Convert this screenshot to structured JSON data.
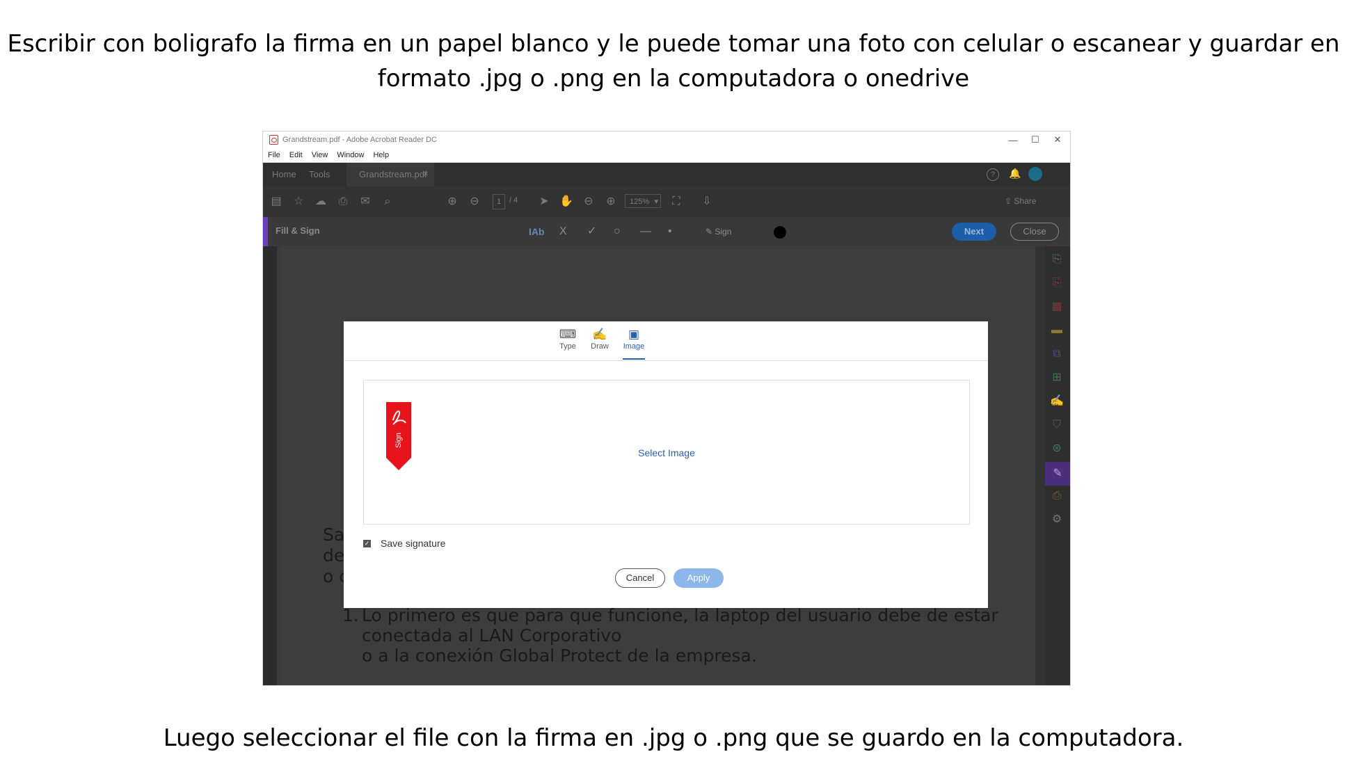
{
  "captions": {
    "top_line1": "Escribir con boligrafo la firma en un papel blanco y le puede tomar una foto con celular o escanear y guardar en",
    "top_line2": "formato .jpg o .png en la computadora o onedrive",
    "bottom": "Luego seleccionar el file con la firma en .jpg o .png que se guardo en la computadora."
  },
  "window": {
    "title": "Grandstream.pdf - Adobe Acrobat Reader DC",
    "controls": {
      "minimize": "—",
      "maximize": "☐",
      "close": "✕"
    }
  },
  "menu": [
    "File",
    "Edit",
    "View",
    "Window",
    "Help"
  ],
  "tabs": {
    "home": "Home",
    "tools": "Tools",
    "document": "Grandstream.pdf",
    "close_tab": "×"
  },
  "toolbar": {
    "page_current": "1",
    "page_total": "/ 4",
    "zoom": "125%",
    "share": "Share",
    "icons": [
      "save-icon",
      "star-icon",
      "cloud-upload-icon",
      "print-icon",
      "mail-icon",
      "search-icon",
      "page-up-icon",
      "page-down-icon",
      "select-icon",
      "hand-icon",
      "zoom-out-icon",
      "zoom-in-icon",
      "fit-page-icon",
      "scroll-mode-icon"
    ]
  },
  "fill_sign": {
    "label": "Fill & Sign",
    "text_tool": "IAb",
    "cross_tool": "X",
    "check_tool": "✓",
    "circle_tool": "○",
    "line_tool": "—",
    "dot_tool": "•",
    "sign_label": "Sign",
    "next": "Next",
    "close": "Close"
  },
  "document": {
    "frag_1": "Sa",
    "frag_2": "de",
    "frag_3": "o c",
    "item_number": "1.",
    "line_1": "Lo primero es que para que funcione, la laptop del usuario debe de estar",
    "line_2": "conectada al LAN Corporativo",
    "line_3": "o a la conexión Global Protect de la empresa."
  },
  "dialog": {
    "tabs": [
      {
        "label": "Type",
        "icon": "keyboard-icon"
      },
      {
        "label": "Draw",
        "icon": "pen-icon"
      },
      {
        "label": "Image",
        "icon": "image-icon"
      }
    ],
    "active_tab": "Image",
    "flag_text": "Sign",
    "select_image": "Select Image",
    "save_signature": "Save signature",
    "save_checked": true,
    "cancel": "Cancel",
    "apply": "Apply"
  },
  "colors": {
    "accent_blue": "#2a5fa8",
    "apply_disabled": "#8db7ea",
    "fill_sign_purple": "#6c3fb5",
    "sign_flag_red": "#e8141b"
  }
}
